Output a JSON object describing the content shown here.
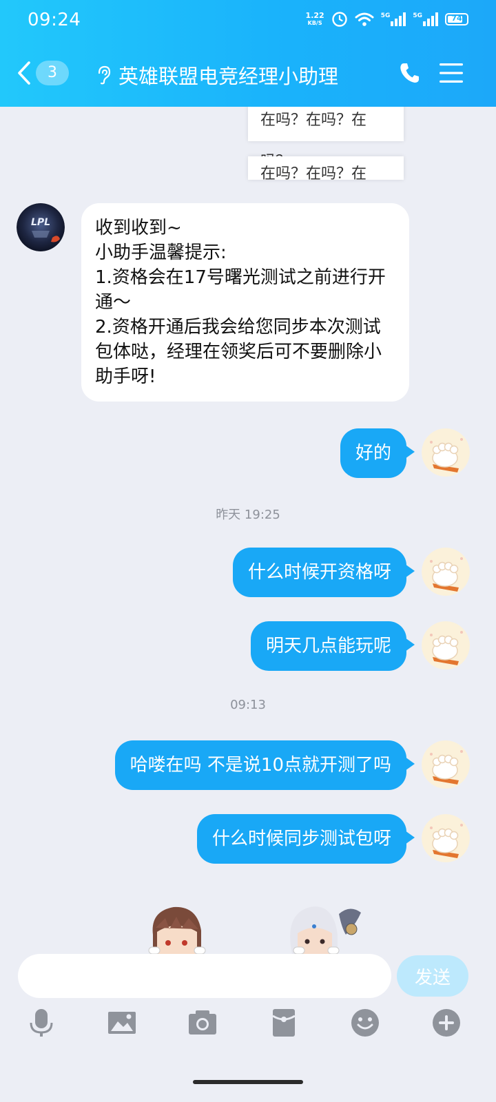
{
  "status_bar": {
    "time": "09:24",
    "net_speed_value": "1.22",
    "net_speed_unit": "KB/S",
    "signal1_label": "5G",
    "signal2_label": "5G",
    "battery": "74"
  },
  "header": {
    "back_count": "3",
    "title": "英雄联盟电竞经理小助理"
  },
  "quoted": {
    "line1": "在吗？在吗？在吗？",
    "line2": "在吗？在吗？在吗？"
  },
  "messages": {
    "incoming_1": "收到收到~\n小助手温馨提示:\n1.资格会在17号曙光测试之前进行开通～\n2.资格开通后我会给您同步本次测试包体哒，经理在领奖后可不要删除小助手呀!",
    "out_1": "好的",
    "time_1": "昨天 19:25",
    "out_2": "什么时候开资格呀",
    "out_3": "明天几点能玩呢",
    "time_2": "09:13",
    "out_4": "哈喽在吗 不是说10点就开测了吗",
    "out_5": "什么时候同步测试包呀"
  },
  "input": {
    "value": "",
    "placeholder": "",
    "send_label": "发送"
  },
  "avatar_text": "LPL",
  "colors": {
    "header_start": "#22c8fb",
    "header_end": "#1ca8f9",
    "outgoing_bubble": "#19a8f6",
    "background": "#eceef5",
    "send_button": "#bde9fd"
  }
}
